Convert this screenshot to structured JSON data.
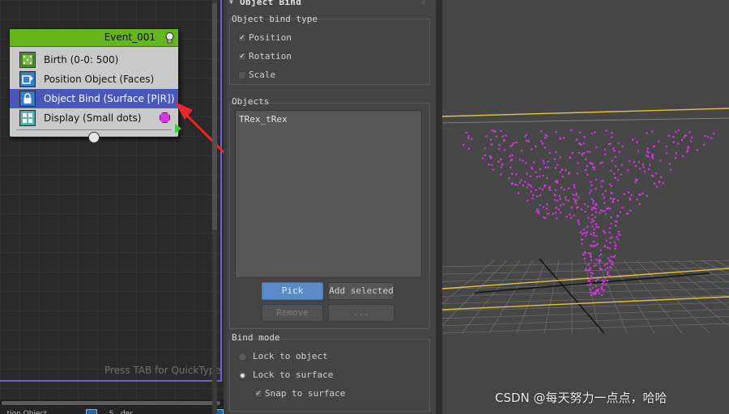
{
  "particle_view": {
    "event": {
      "name": "Event_001",
      "operators": [
        {
          "label": "Birth (0-0: 500)",
          "icon": "birth-icon"
        },
        {
          "label": "Position Object (Faces)",
          "icon": "position-object-icon"
        },
        {
          "label": "Object Bind (Surface [P|R])",
          "icon": "object-bind-icon",
          "selected": true
        },
        {
          "label": "Display (Small dots)",
          "icon": "display-icon"
        }
      ],
      "display_color": "#d23adf",
      "header_color": "#67b51e",
      "selection_color": "#4a56ba"
    },
    "quicktype_hint": "Press TAB for QuickType",
    "depot_items": [
      "...tion Object",
      "...S...der"
    ]
  },
  "panel": {
    "rollout_title": "Object Bind",
    "bind_type": {
      "label": "Object bind type",
      "options": [
        {
          "label": "Position",
          "checked": true
        },
        {
          "label": "Rotation",
          "checked": true
        },
        {
          "label": "Scale",
          "checked": false
        }
      ]
    },
    "objects": {
      "label": "Objects",
      "items": [
        "TRex_tRex"
      ],
      "buttons": {
        "pick": "Pick",
        "add_selected": "Add selected",
        "remove": "Remove",
        "more": "..."
      }
    },
    "bind_mode": {
      "label": "Bind mode",
      "options": [
        {
          "label": "Lock to object",
          "selected": false
        },
        {
          "label": "Lock to surface",
          "selected": true
        }
      ],
      "snap_to_surface": {
        "label": "Snap to surface",
        "checked": true
      }
    }
  },
  "viewport": {
    "particle_color": "#d23adf",
    "bbox_color": "#e6c23c"
  },
  "watermark": "CSDN @每天努力一点点，哈哈"
}
